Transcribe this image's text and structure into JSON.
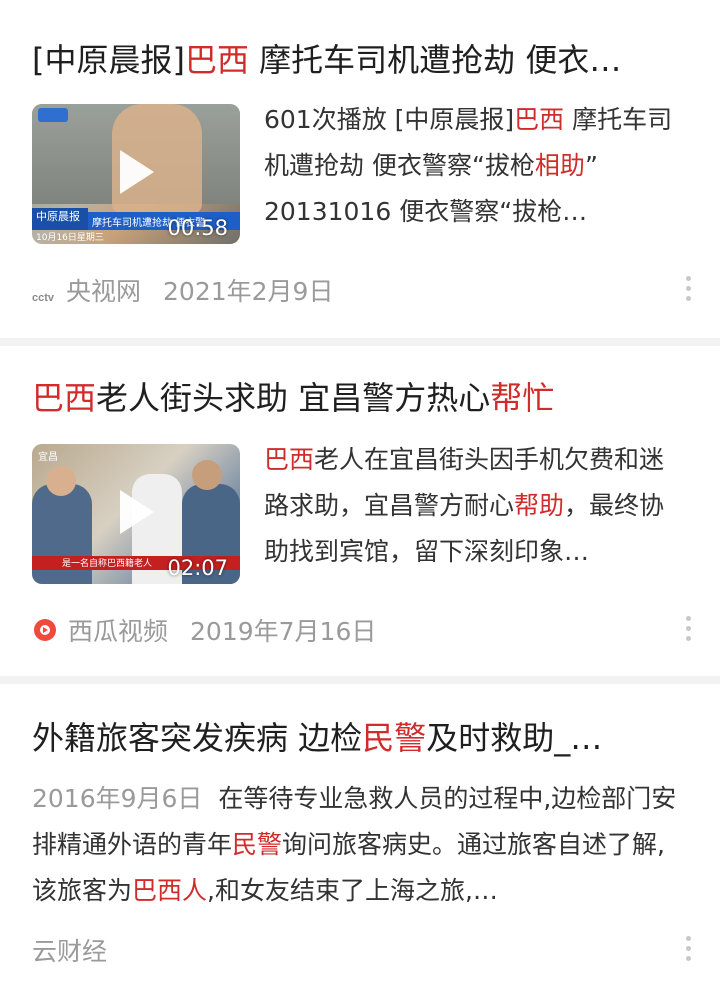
{
  "results": [
    {
      "title_parts": [
        "[中原晨报]",
        "巴西",
        " 摩托车司机遭抢劫 便衣…"
      ],
      "duration": "00:58",
      "thumb_caption_top": "中原晨报",
      "thumb_caption_bar": "摩托车司机遭抢劫 便衣警",
      "thumb_date": "10月16日星期三",
      "snippet_parts": [
        "601次播放  [中原晨报]",
        "巴西",
        " 摩托车司机遭抢劫 便衣警察“拔枪",
        "相",
        "助",
        "” 20131016 便衣警察“拔枪…"
      ],
      "source": "央视网",
      "source_logo": "cctv-logo",
      "date": "2021年2月9日"
    },
    {
      "title_parts": [
        "巴西",
        "老人街头求助 宜昌警方热心",
        "帮忙"
      ],
      "duration": "02:07",
      "thumb_caption_top": "宜昌",
      "thumb_caption_bar": "是一名自称巴西籍老人",
      "snippet_parts": [
        "巴西",
        "老人在宜昌街头因手机欠费和迷路求助，宜昌警方耐心",
        "帮助",
        "，最终协助找到宾馆，留下深刻印象…"
      ],
      "source": "西瓜视频",
      "source_logo": "xigua-icon",
      "date": "2019年7月16日"
    },
    {
      "title_parts": [
        "外籍旅客突发疾病 边检",
        "民警",
        "及时救助_…"
      ],
      "date": "2016年9月6日",
      "snippet_parts": [
        "在等待专业急救人员的过程中,边检部门安排精通外语的青年",
        "民警",
        "询问旅客病史。通过旅客自述了解,该旅客为",
        "巴西人",
        ",和女友结束了上海之旅,…"
      ],
      "source": "云财经"
    }
  ],
  "colors": {
    "highlight": "#d12c2c",
    "meta": "#9a9a9a",
    "divider": "#f2f2f2"
  }
}
